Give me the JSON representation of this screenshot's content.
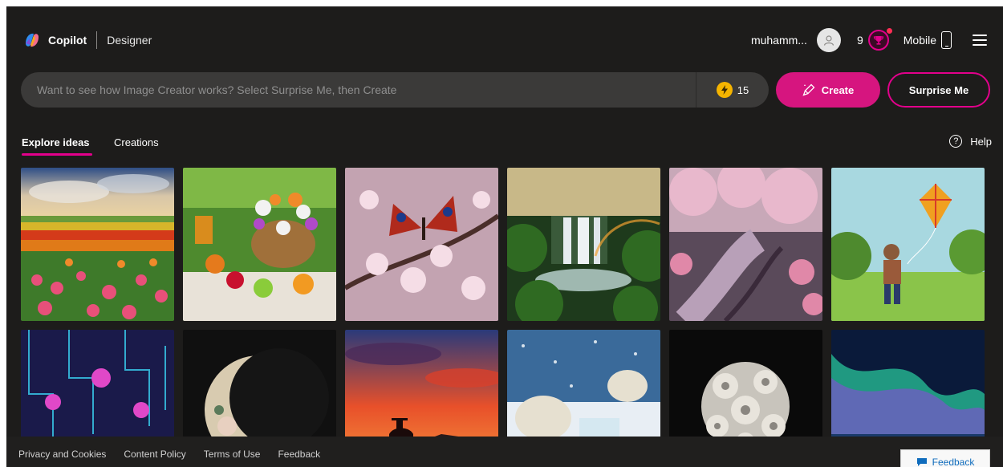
{
  "brand": {
    "name": "Copilot",
    "product": "Designer"
  },
  "header": {
    "username": "muhamm...",
    "rewards_count": "9",
    "mobile_label": "Mobile"
  },
  "search": {
    "placeholder": "Want to see how Image Creator works? Select Surprise Me, then Create",
    "value": "",
    "boosts": "15"
  },
  "actions": {
    "create_label": "Create",
    "surprise_label": "Surprise Me"
  },
  "tabs": [
    {
      "label": "Explore ideas",
      "active": true
    },
    {
      "label": "Creations",
      "active": false
    }
  ],
  "help_label": "Help",
  "gallery": [
    {
      "subject": "tulip-field"
    },
    {
      "subject": "picnic-flower-basket"
    },
    {
      "subject": "butterfly-blossoms"
    },
    {
      "subject": "jungle-waterfall"
    },
    {
      "subject": "cherry-blossom-river"
    },
    {
      "subject": "boy-flying-kite"
    },
    {
      "subject": "neon-circuit-garden"
    },
    {
      "subject": "crescent-moon-flowers"
    },
    {
      "subject": "cowboy-sunset"
    },
    {
      "subject": "polar-bears-lemonade"
    },
    {
      "subject": "silver-flower-brooch"
    },
    {
      "subject": "aurora-borealis"
    }
  ],
  "footer": {
    "links": [
      "Privacy and Cookies",
      "Content Policy",
      "Terms of Use",
      "Feedback"
    ],
    "feedback_button": "Feedback"
  },
  "colors": {
    "background": "#1d1c1b",
    "accent": "#e3008c",
    "search_bg": "#3b3a39",
    "boost_bolt": "#f5b400"
  }
}
